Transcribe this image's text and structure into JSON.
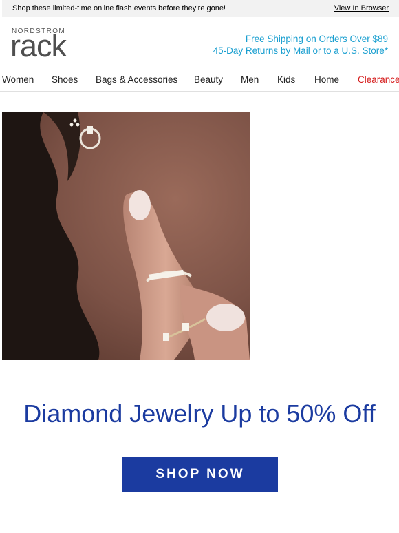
{
  "topbar": {
    "promo_text": "Shop these limited-time online flash events before they’re gone!",
    "view_in_browser": "View In Browser"
  },
  "brand": {
    "top": "NORDSTROM",
    "name": "rack"
  },
  "shipping": {
    "line1": "Free Shipping on Orders Over $89",
    "line2": "45-Day Returns by Mail or to a U.S. Store*"
  },
  "nav": {
    "items": [
      "Women",
      "Shoes",
      "Bags & Accessories",
      "Beauty",
      "Men",
      "Kids",
      "Home",
      "Clearance"
    ]
  },
  "hero": {
    "headline": "Diamond Jewelry Up to 50% Off",
    "cta": "SHOP NOW"
  },
  "colors": {
    "accent_blue": "#1b3ba0",
    "shipping_blue": "#1a9fd0",
    "clearance_red": "#d51c1c"
  }
}
